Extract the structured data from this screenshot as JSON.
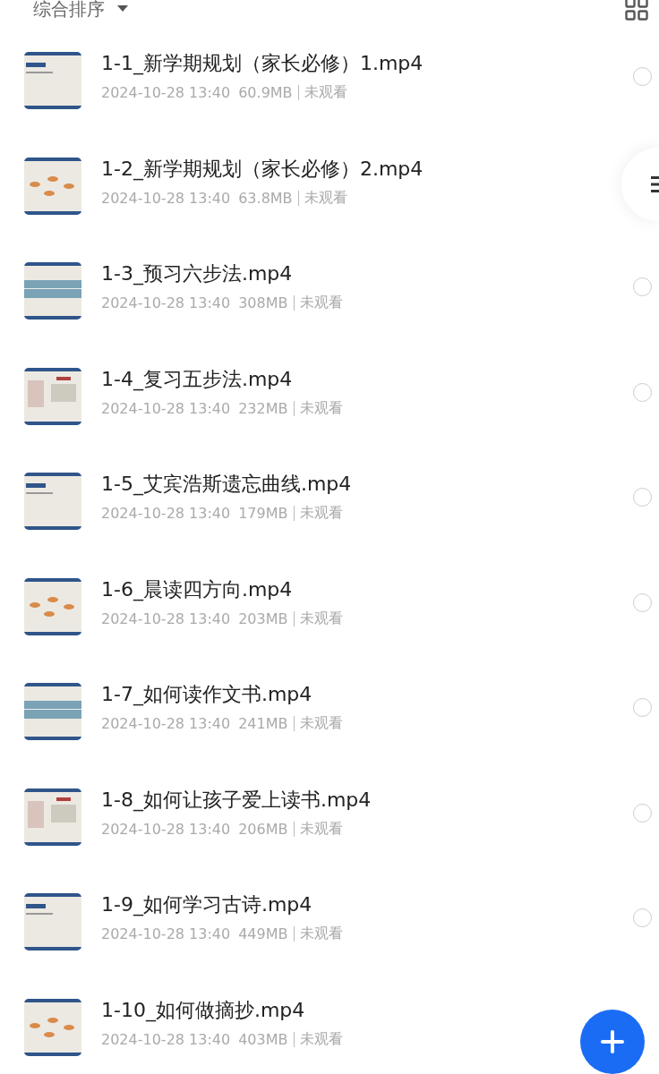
{
  "sort": {
    "label": "综合排序"
  },
  "files": [
    {
      "title": "1-1_新学期规划（家长必修）1.mp4",
      "date": "2024-10-28 13:40",
      "size": "60.9MB",
      "status": "未观看",
      "selected": false
    },
    {
      "title": "1-2_新学期规划（家长必修）2.mp4",
      "date": "2024-10-28 13:40",
      "size": "63.8MB",
      "status": "未观看"
    },
    {
      "title": "1-3_预习六步法.mp4",
      "date": "2024-10-28 13:40",
      "size": "308MB",
      "status": "未观看",
      "selected": false
    },
    {
      "title": "1-4_复习五步法.mp4",
      "date": "2024-10-28 13:40",
      "size": "232MB",
      "status": "未观看",
      "selected": false
    },
    {
      "title": "1-5_艾宾浩斯遗忘曲线.mp4",
      "date": "2024-10-28 13:40",
      "size": "179MB",
      "status": "未观看",
      "selected": false
    },
    {
      "title": "1-6_晨读四方向.mp4",
      "date": "2024-10-28 13:40",
      "size": "203MB",
      "status": "未观看",
      "selected": false
    },
    {
      "title": "1-7_如何读作文书.mp4",
      "date": "2024-10-28 13:40",
      "size": "241MB",
      "status": "未观看",
      "selected": false
    },
    {
      "title": "1-8_如何让孩子爱上读书.mp4",
      "date": "2024-10-28 13:40",
      "size": "206MB",
      "status": "未观看",
      "selected": false
    },
    {
      "title": "1-9_如何学习古诗.mp4",
      "date": "2024-10-28 13:40",
      "size": "449MB",
      "status": "未观看",
      "selected": false
    },
    {
      "title": "1-10_如何做摘抄.mp4",
      "date": "2024-10-28 13:40",
      "size": "403MB",
      "status": "未观看"
    }
  ]
}
